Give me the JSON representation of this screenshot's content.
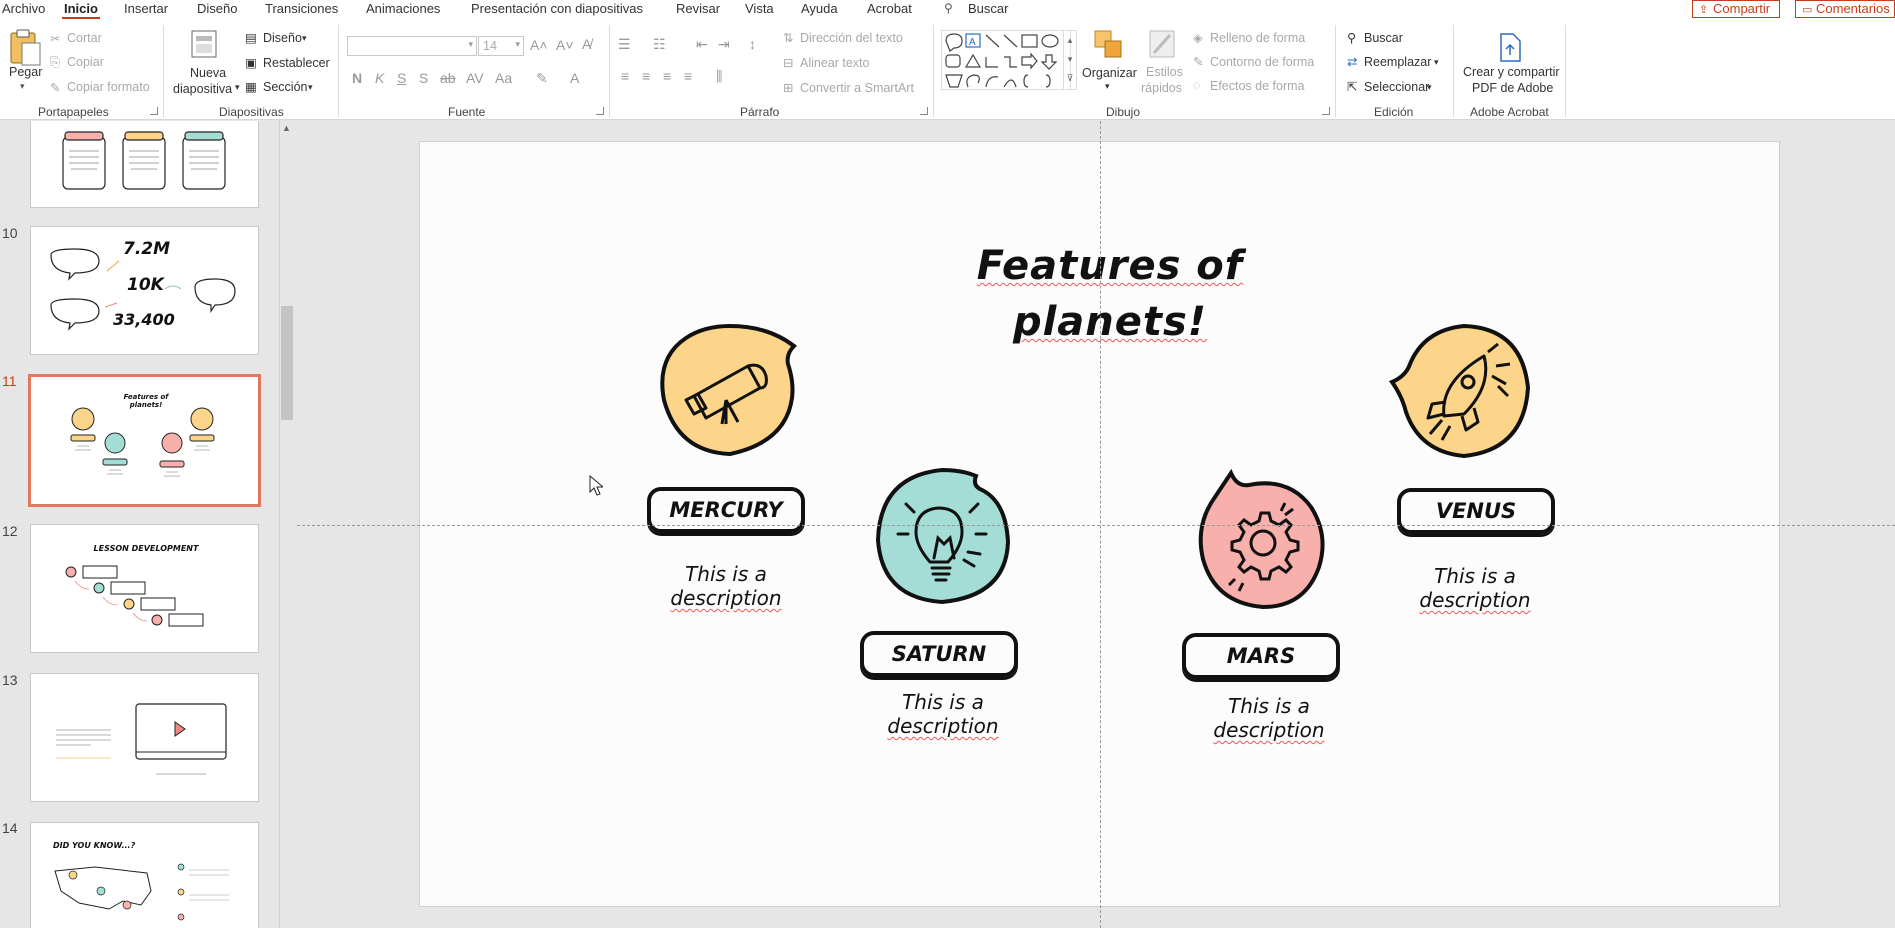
{
  "menu": {
    "tabs": [
      "Archivo",
      "Inicio",
      "Insertar",
      "Diseño",
      "Transiciones",
      "Animaciones",
      "Presentación con diapositivas",
      "Revisar",
      "Vista",
      "Ayuda",
      "Acrobat"
    ],
    "active": "Inicio",
    "search": "Buscar",
    "share": "Compartir",
    "comments": "Comentarios"
  },
  "ribbon": {
    "portapapeles": {
      "label": "Portapapeles",
      "paste": "Pegar",
      "cut": "Cortar",
      "copy": "Copiar",
      "format_painter": "Copiar formato"
    },
    "diapositivas": {
      "label": "Diapositivas",
      "new_slide_line1": "Nueva",
      "new_slide_line2": "diapositiva",
      "layout": "Diseño",
      "reset": "Restablecer",
      "section": "Sección"
    },
    "fuente": {
      "label": "Fuente",
      "font_name": "",
      "font_size": "14"
    },
    "parrafo": {
      "label": "Párrafo",
      "text_direction": "Dirección del texto",
      "align_text": "Alinear texto",
      "smartart": "Convertir a SmartArt"
    },
    "dibujo": {
      "label": "Dibujo",
      "arrange": "Organizar",
      "quick_styles_1": "Estilos",
      "quick_styles_2": "rápidos",
      "fill": "Relleno de forma",
      "outline": "Contorno de forma",
      "effects": "Efectos de forma"
    },
    "edicion": {
      "label": "Edición",
      "find": "Buscar",
      "replace": "Reemplazar",
      "select": "Seleccionar"
    },
    "acrobat": {
      "label": "Adobe Acrobat",
      "create_line1": "Crear y compartir",
      "create_line2": "PDF de Adobe"
    }
  },
  "thumbnails": [
    {
      "number": "",
      "top_partial": true
    },
    {
      "number": "10",
      "stats": [
        "7.2M",
        "10K",
        "33,400"
      ]
    },
    {
      "number": "11",
      "active": true,
      "title": "Features of planets!"
    },
    {
      "number": "12",
      "title": "Lesson development"
    },
    {
      "number": "13"
    },
    {
      "number": "14",
      "title": "Did you know...?"
    }
  ],
  "slide": {
    "title_line1": "Features of",
    "title_line2": "planets!",
    "planets": [
      {
        "name": "MERCURY",
        "desc_line1": "This is a",
        "desc_line2": "description",
        "color": "#fcd58a",
        "icon": "telescope-icon"
      },
      {
        "name": "SATURN",
        "desc_line1": "This is a",
        "desc_line2": "description",
        "color": "#a3ddd5",
        "icon": "lightbulb-icon"
      },
      {
        "name": "MARS",
        "desc_line1": "This is a",
        "desc_line2": "description",
        "color": "#f8b0ac",
        "icon": "gear-icon"
      },
      {
        "name": "VENUS",
        "desc_line1": "This is a",
        "desc_line2": "description",
        "color": "#fcd58a",
        "icon": "rocket-icon"
      }
    ]
  },
  "colors": {
    "accent": "#c43e1c",
    "yellow": "#fcd58a",
    "teal": "#a3ddd5",
    "pink": "#f8b0ac"
  }
}
